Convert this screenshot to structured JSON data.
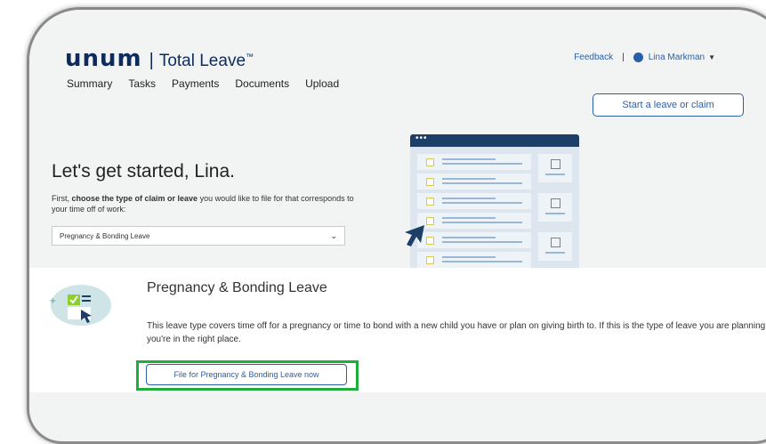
{
  "brand": {
    "logo_text": "unum",
    "separator": "|",
    "product": "Total Leave",
    "trademark": "™"
  },
  "header": {
    "feedback_label": "Feedback",
    "separator": "|",
    "user_name": "Lina Markman"
  },
  "nav": {
    "items": [
      "Summary",
      "Tasks",
      "Payments",
      "Documents",
      "Upload"
    ]
  },
  "start_button_label": "Start a leave or claim",
  "intro": {
    "greeting": "Let's get started, Lina.",
    "sub_prefix": "First, ",
    "sub_bold": "choose the type of claim or leave",
    "sub_suffix": " you would like to file for that corresponds to your time off of work:"
  },
  "claim_type_select": {
    "selected": "Pregnancy & Bonding Leave"
  },
  "leave_section": {
    "title": "Pregnancy & Bonding Leave",
    "description": "This leave type covers time off for a pregnancy or time to bond with a new child you have or plan on giving birth to. If this is the type of leave you are planning, you're in the right place.",
    "file_button_label": "File for Pregnancy & Bonding Leave now"
  },
  "colors": {
    "brand_navy": "#0e2b5c",
    "link_blue": "#2a5fa8",
    "highlight_green": "#1fae3b",
    "illustration_check_green": "#8fce2f"
  },
  "icons": {
    "user": "user-circle-icon",
    "caret": "caret-down-icon",
    "select_chevron": "chevron-down-icon",
    "pointer": "pointer-arrow-icon",
    "leave": "checklist-cursor-icon"
  }
}
